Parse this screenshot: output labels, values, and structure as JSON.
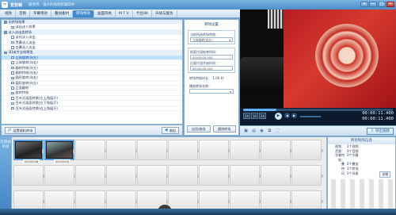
{
  "app": {
    "title": "爱剪辑",
    "slogan": "最易用、强大的视频剪辑软件",
    "window_buttons": [
      "▾",
      "—",
      "□",
      "✕"
    ]
  },
  "tabs": [
    "视频",
    "音频",
    "字幕特效",
    "叠加素材",
    "转场特效",
    "画面风格",
    "M T V",
    "卡拉OK",
    "升级与服务"
  ],
  "tree": [
    {
      "label": "无转场效果",
      "type": "group"
    },
    {
      "label": "淡出淡入效果",
      "type": "item"
    },
    {
      "label": "淡入淡出类转场",
      "type": "group"
    },
    {
      "label": "淡化淡入淡出",
      "type": "item"
    },
    {
      "label": "黑幕淡入淡出",
      "type": "item"
    },
    {
      "label": "白幕淡入淡出",
      "type": "item"
    },
    {
      "label": "3D或专业效果类",
      "type": "group"
    },
    {
      "label": "立体旋转(向左)",
      "type": "selected"
    },
    {
      "label": "立体旋转(向右)",
      "type": "item"
    },
    {
      "label": "翻转特效(向左)",
      "type": "item"
    },
    {
      "label": "翻转特效(向右)",
      "type": "item"
    },
    {
      "label": "圆形旋转(向右)",
      "type": "item"
    },
    {
      "label": "圆形旋转(向左)",
      "type": "item"
    },
    {
      "label": "正面翻转",
      "type": "item"
    },
    {
      "label": "旋转特效",
      "type": "item"
    },
    {
      "label": "百叶式画面转换(左上角展开)",
      "type": "item"
    },
    {
      "label": "百叶式画面转换(左下角展开)",
      "type": "item"
    },
    {
      "label": "百叶式画面转换(右上角展开)",
      "type": "item"
    }
  ],
  "left_toolbar": {
    "random_label": "设置随机转场",
    "collapse_label": "收起"
  },
  "settings": {
    "title": "转场设置",
    "current_label": "当前所选转场特效：",
    "current_value": "立体旋转(向左)",
    "start_label": "前面片段结束时间：",
    "start_value": "00:00:00.000",
    "end_label": "后面片段开始时间：",
    "end_value": "00:00:00.000",
    "duration_label": "转场特效时长：",
    "duration_value": "1.00 秒",
    "prefix_label": "播放转场名称：",
    "apply_btn": "应用/修改",
    "delete_btn": "删除转场"
  },
  "player": {
    "zoom": [
      "2X",
      "1X",
      "2X"
    ],
    "time_current": "00:00:11.400",
    "time_total": "00:00:11.400",
    "export_label": "导出视频"
  },
  "timeline": {
    "label": "已添加片段",
    "clips": [
      {
        "name": "00:00:08"
      },
      {
        "name": "00:00:05"
      }
    ]
  },
  "info": {
    "title": "所有制作信息",
    "rows": [
      {
        "k": "视频：",
        "v": "2个视频"
      },
      {
        "k": "音频：",
        "v": "0个音频"
      },
      {
        "k": "字幕特效：",
        "v": "0个字幕"
      },
      {
        "k": "叠",
        "v": "0个叠加"
      },
      {
        "k": "特",
        "v": "1个转场"
      },
      {
        "k": "风",
        "v": "0个风格"
      }
    ],
    "tag": "详细"
  }
}
